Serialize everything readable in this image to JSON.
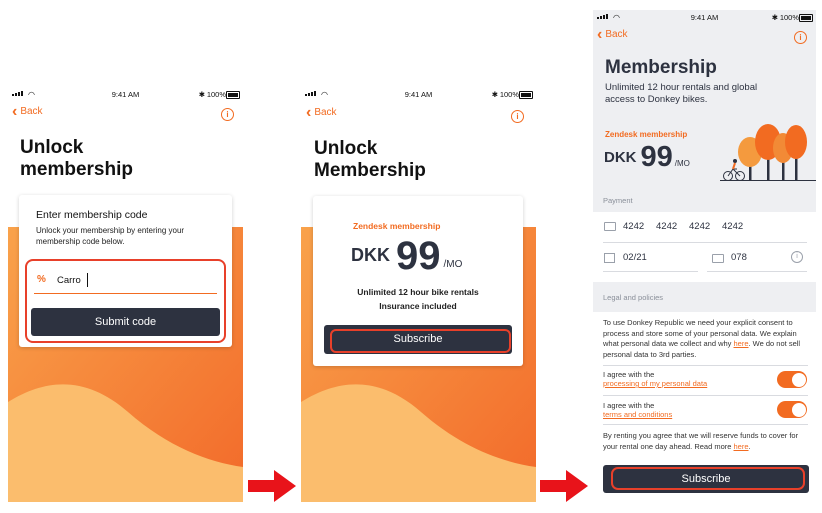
{
  "status_bar": {
    "time": "9:41 AM",
    "battery": "100%"
  },
  "screen1": {
    "back": "Back",
    "title_line1": "Unlock",
    "title_line2": "membership",
    "card_heading": "Enter membership code",
    "card_desc": "Unlock your membership by entering your membership code below.",
    "input_value": "Carro",
    "submit": "Submit code"
  },
  "screen2": {
    "back": "Back",
    "title_line1": "Unlock",
    "title_line2": "Membership",
    "plan_name": "Zendesk membership",
    "currency": "DKK",
    "price": "99",
    "per": "/MO",
    "feature1": "Unlimited 12 hour bike rentals",
    "feature2": "Insurance included",
    "subscribe": "Subscribe"
  },
  "screen3": {
    "back": "Back",
    "title": "Membership",
    "subtitle": "Unlimited 12 hour rentals and global access to Donkey bikes.",
    "plan_name": "Zendesk membership",
    "currency": "DKK",
    "price": "99",
    "per": "/MO",
    "payment_label": "Payment",
    "card_number": [
      "4242",
      "4242",
      "4242",
      "4242"
    ],
    "expiry": "02/21",
    "cvc": "078",
    "legal_label": "Legal and policies",
    "consent_text": "To use Donkey Republic we need your explicit consent to process and store some of your personal data. We explain what personal data we collect and why ",
    "consent_link": "here",
    "consent_tail": ". We do not sell personal data to 3rd parties.",
    "agree1_prefix": "I agree with the",
    "agree1_link": "processing of my personal data",
    "agree2_prefix": "I agree with the",
    "agree2_link": "terms and conditions",
    "reserve_text": "By renting you agree that we will reserve funds to cover for your rental one day ahead. Read more ",
    "reserve_link": "here",
    "reserve_tail": ".",
    "subscribe": "Subscribe"
  },
  "colors": {
    "accent": "#f26b21",
    "dark_button": "#2d3240",
    "highlight": "#e8402a",
    "arrow": "#e8131a"
  }
}
